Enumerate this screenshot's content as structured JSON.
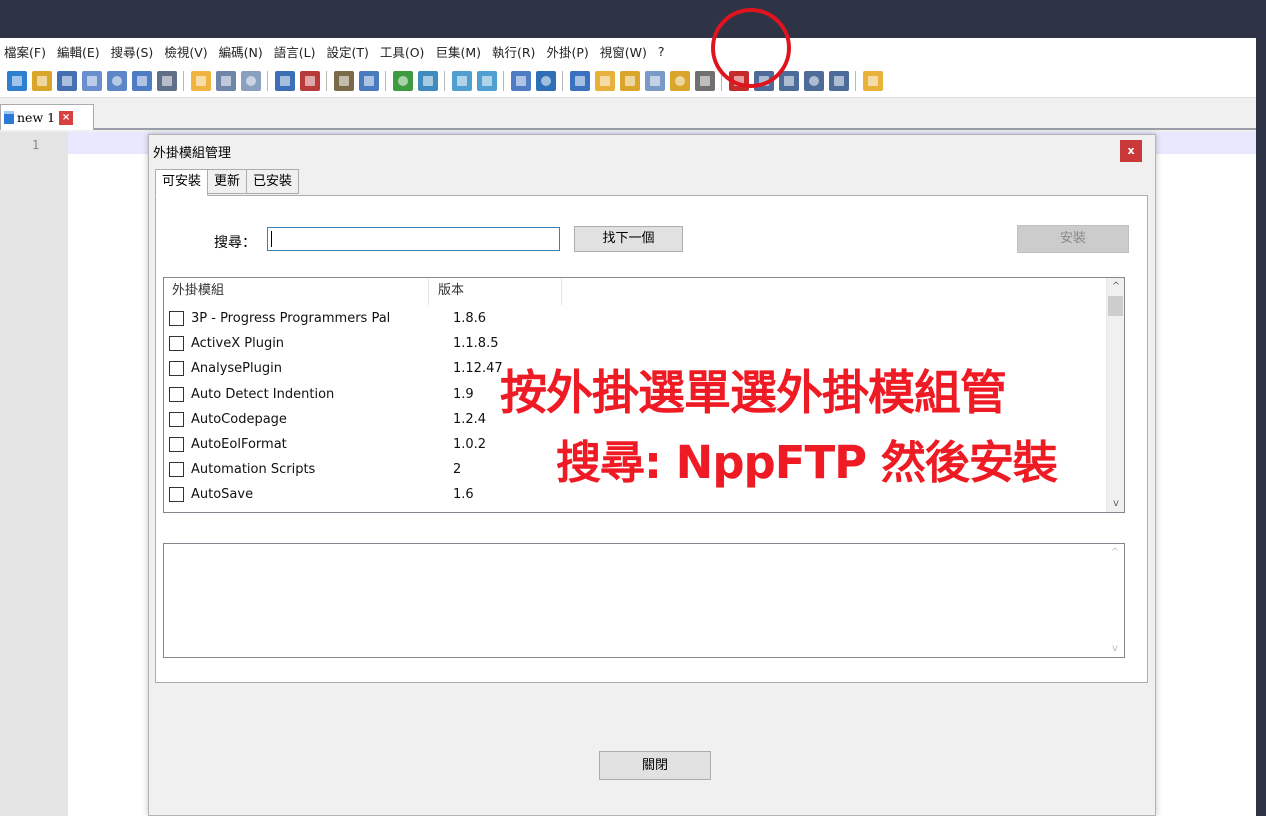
{
  "menu": [
    "檔案(F)",
    "編輯(E)",
    "搜尋(S)",
    "檢視(V)",
    "編碼(N)",
    "語言(L)",
    "設定(T)",
    "工具(O)",
    "巨集(M)",
    "執行(R)",
    "外掛(P)",
    "視窗(W)",
    "?"
  ],
  "toolbar_colors": [
    "#2f7fd0",
    "#d9a52b",
    "#466fb3",
    "#6a8fcf",
    "#5d86c8",
    "#4f7dc4",
    "#5f6f88",
    "sep",
    "#f0b340",
    "#6f86a8",
    "#8aa0bf",
    "sep",
    "#3c6fb8",
    "#b73b3b",
    "sep",
    "#7a6a4a",
    "#4a7bbf",
    "sep",
    "#3f9b3f",
    "#3f8bbf",
    "sep",
    "#4f9fd0",
    "#4f9fd0",
    "sep",
    "#4f7dc4",
    "#2f6fb8",
    "sep",
    "#3a72c0",
    "#e8b23a",
    "#d9a52b",
    "#7a9bc8",
    "#d9a52b",
    "#707070",
    "sep",
    "#c62b2b",
    "#4d6c9a",
    "#4d6c9a",
    "#4d6c9a",
    "#4d6c9a",
    "sep",
    "#e8b23a"
  ],
  "doc_tab": {
    "label": "new 1",
    "close": "×"
  },
  "editor": {
    "line_number": "1"
  },
  "dialog": {
    "title": "外掛模組管理",
    "close": "x",
    "tabs": [
      "可安裝",
      "更新",
      "已安裝"
    ],
    "search_label": "搜尋：",
    "search_value": "",
    "find_next": "找下一個",
    "install": "安裝",
    "columns": [
      "外掛模組",
      "版本"
    ],
    "plugins": [
      {
        "name": "3P - Progress Programmers Pal",
        "version": "1.8.6"
      },
      {
        "name": "ActiveX Plugin",
        "version": "1.1.8.5"
      },
      {
        "name": "AnalysePlugin",
        "version": "1.12.47"
      },
      {
        "name": "Auto Detect Indention",
        "version": "1.9"
      },
      {
        "name": "AutoCodepage",
        "version": "1.2.4"
      },
      {
        "name": "AutoEolFormat",
        "version": "1.0.2"
      },
      {
        "name": "Automation Scripts",
        "version": "2"
      },
      {
        "name": "AutoSave",
        "version": "1.6"
      }
    ],
    "close_button": "關閉"
  },
  "scroll_arrows": {
    "up": "▲",
    "down": "▼",
    "up_light": "^",
    "down_light": "v"
  },
  "annotation": {
    "line1": "按外掛選單選外掛模組管",
    "line2": "搜尋: NppFTP 然後安裝"
  },
  "colors": {
    "annotation_red": "#ee1b24",
    "frame": "#2e3446"
  }
}
